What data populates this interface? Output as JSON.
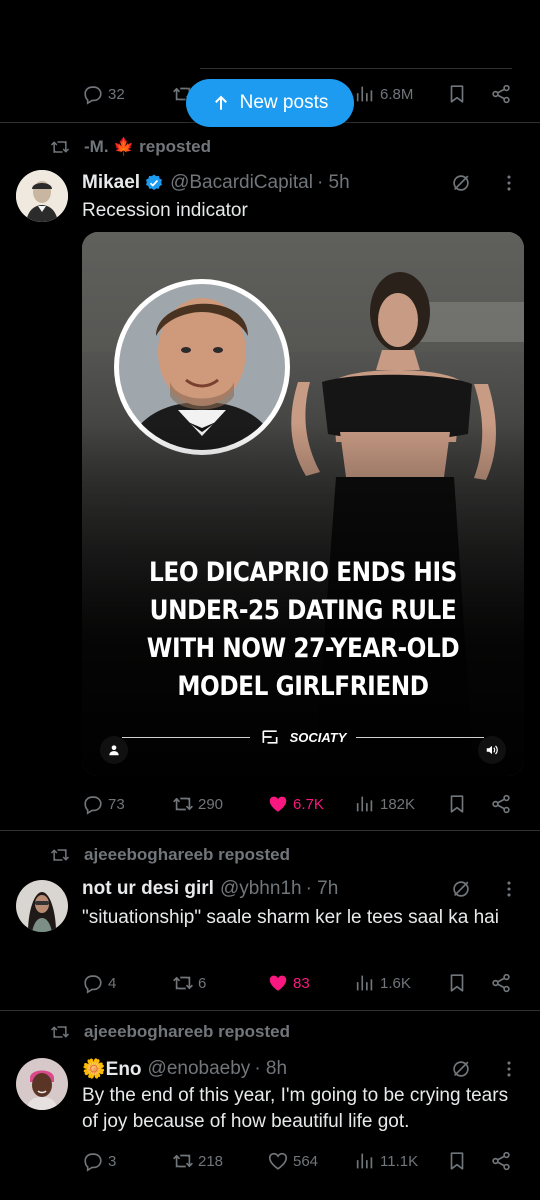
{
  "top_stats": {
    "replies": "32",
    "views": "6.8M"
  },
  "new_posts": {
    "label": "New posts"
  },
  "posts": [
    {
      "reposted_by": "-M. 🍁 reposted",
      "name": "Mikael",
      "verified": true,
      "handle": "@BacardiCapital",
      "time": "· 5h",
      "text": "Recession indicator",
      "media": {
        "headline": [
          "LEO DICAPRIO ENDS HIS",
          "UNDER-25 DATING RULE",
          "WITH NOW 27-YEAR-OLD",
          "MODEL GIRLFRIEND"
        ],
        "brand": "SOCIATY"
      },
      "stats": {
        "replies": "73",
        "reposts": "290",
        "likes": "6.7K",
        "views": "182K",
        "liked": true
      }
    },
    {
      "reposted_by": "ajeeeboghareeb reposted",
      "name": "not ur desi girl",
      "verified": false,
      "handle": "@ybhn1h",
      "time": "· 7h",
      "text": "\"situationship\" saale sharm ker le tees saal ka hai",
      "stats": {
        "replies": "4",
        "reposts": "6",
        "likes": "83",
        "views": "1.6K",
        "liked": true
      }
    },
    {
      "reposted_by": "ajeeeboghareeb reposted",
      "name": "🌼Eno",
      "verified": false,
      "handle": "@enobaeby",
      "time": "· 8h",
      "text": "By the end of this year, I'm going to be crying tears of joy because of how beautiful life got.",
      "stats": {
        "replies": "3",
        "reposts": "218",
        "likes": "564",
        "views": "11.1K",
        "liked": false
      }
    }
  ],
  "colors": {
    "accent": "#1d9bf0",
    "like": "#f91880",
    "muted": "#71767b",
    "text": "#e7e9ea",
    "divider": "#2f3336"
  }
}
